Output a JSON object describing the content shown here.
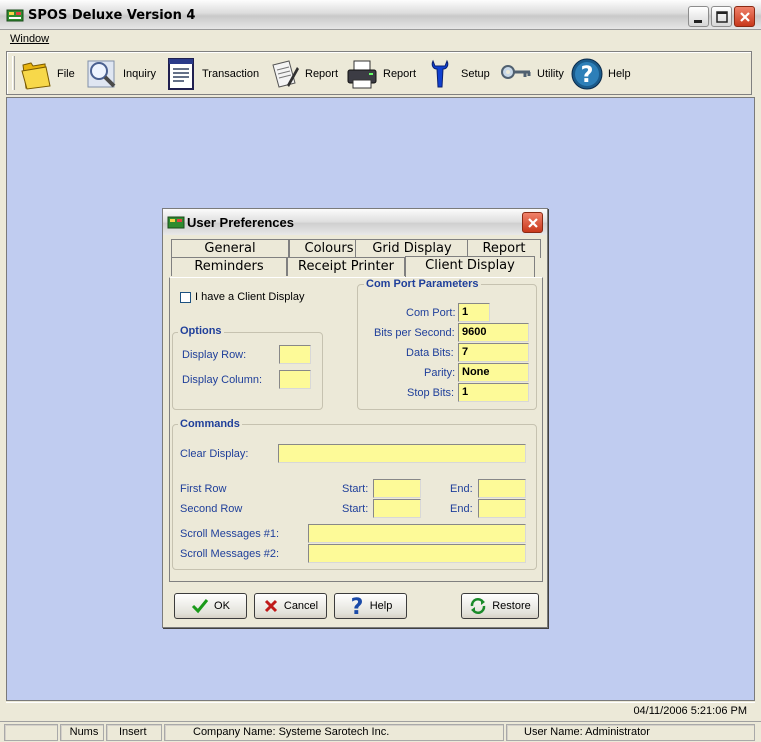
{
  "window": {
    "title": "SPOS Deluxe Version 4"
  },
  "menu": {
    "items": [
      {
        "label": "Window"
      }
    ]
  },
  "toolbar": {
    "items": [
      {
        "label": "File",
        "icon": "folder-icon"
      },
      {
        "label": "Inquiry",
        "icon": "magnifier-icon"
      },
      {
        "label": "Transaction",
        "icon": "form-icon"
      },
      {
        "label": "Report",
        "icon": "report-pen-icon"
      },
      {
        "label": "Report",
        "icon": "printer-icon"
      },
      {
        "label": "Setup",
        "icon": "wrench-icon"
      },
      {
        "label": "Utility",
        "icon": "keys-icon"
      },
      {
        "label": "Help",
        "icon": "help-icon"
      }
    ]
  },
  "dialog": {
    "title": "User Preferences",
    "tabs_back": [
      "General",
      "Colours",
      "Grid Display",
      "Report"
    ],
    "tabs_front": [
      "Reminders",
      "Receipt Printer",
      "Client Display"
    ],
    "active_tab": "Client Display",
    "client_display_checkbox": "I have a Client Display",
    "options": {
      "title": "Options",
      "display_row_label": "Display Row:",
      "display_row_value": "",
      "display_column_label": "Display Column:",
      "display_column_value": ""
    },
    "com_port": {
      "title": "Com Port Parameters",
      "com_port_label": "Com Port:",
      "com_port_value": "1",
      "bps_label": "Bits per Second:",
      "bps_value": "9600",
      "data_bits_label": "Data Bits:",
      "data_bits_value": "7",
      "parity_label": "Parity:",
      "parity_value": "None",
      "stop_bits_label": "Stop Bits:",
      "stop_bits_value": "1"
    },
    "commands": {
      "title": "Commands",
      "clear_display_label": "Clear Display:",
      "first_row_label": "First Row",
      "second_row_label": "Second Row",
      "start_label": "Start:",
      "end_label": "End:",
      "scroll1_label": "Scroll Messages #1:",
      "scroll2_label": "Scroll Messages #2:"
    },
    "buttons": {
      "ok": "OK",
      "cancel": "Cancel",
      "help": "Help",
      "restore": "Restore"
    }
  },
  "status": {
    "datetime": "04/11/2006  5:21:06 PM",
    "nums": "Nums",
    "insert": "Insert",
    "company": "Company Name: Systeme Sarotech Inc.",
    "user": "User Name: Administrator"
  },
  "colors": {
    "client_bg": "#c0ccf0",
    "field_bg": "#fdfa98",
    "label_blue": "#1f3f9a"
  }
}
